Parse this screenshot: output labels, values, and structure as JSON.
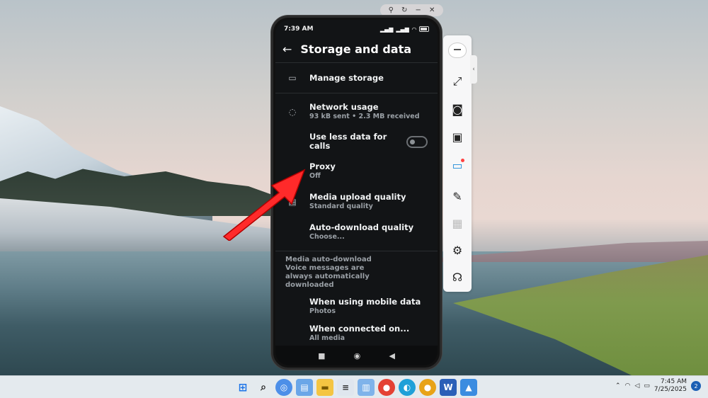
{
  "window_controls": {
    "pin_icon": "pin-icon",
    "refresh_icon": "rotate-icon",
    "minimize": "−",
    "close": "✕"
  },
  "phone": {
    "status": {
      "time": "7:39 AM",
      "right": "▮▮ ▮▮ ◠"
    },
    "appbar": {
      "back": "←",
      "title": "Storage and data"
    },
    "rows": {
      "manage_storage": {
        "title": "Manage storage"
      },
      "network_usage": {
        "title": "Network usage",
        "sub": "93 kB sent • 2.3 MB received"
      },
      "less_data": {
        "title": "Use less data for calls"
      },
      "proxy": {
        "title": "Proxy",
        "sub": "Off"
      },
      "media_upload": {
        "title": "Media upload quality",
        "sub": "Standard quality"
      },
      "auto_download": {
        "title": "Auto-download quality",
        "sub": "Choose..."
      },
      "mobile_data": {
        "title": "When using mobile data",
        "sub": "Photos"
      },
      "connected": {
        "title": "When connected on...",
        "sub": "All media"
      }
    },
    "section": {
      "heading": "Media auto-download",
      "note": "Voice messages are always automatically downloaded"
    },
    "toggle_less_data": false,
    "navbar": {
      "square": "■",
      "circle": "◉",
      "back": "◀"
    }
  },
  "toolbar": {
    "collapse": "‹",
    "items": [
      "mascot-icon",
      "fullscreen-icon",
      "screenshot-icon",
      "record-icon",
      "cast-icon",
      "pen-icon",
      "keyboard-icon",
      "settings-icon",
      "headset-icon"
    ]
  },
  "taskbar": {
    "apps": [
      "windows-start",
      "search",
      "copilot",
      "photos",
      "file-explorer",
      "notepad",
      "notes",
      "chrome",
      "edge",
      "chrome-canary",
      "word",
      "mirror-app"
    ],
    "clock": {
      "time": "7:45 AM",
      "date": "7/25/2025"
    },
    "notification_count": "2"
  },
  "colors": {
    "accent_red": "#ff2a2a",
    "phone_bg": "#121416",
    "toolbar_blue": "#1e8bd8"
  }
}
